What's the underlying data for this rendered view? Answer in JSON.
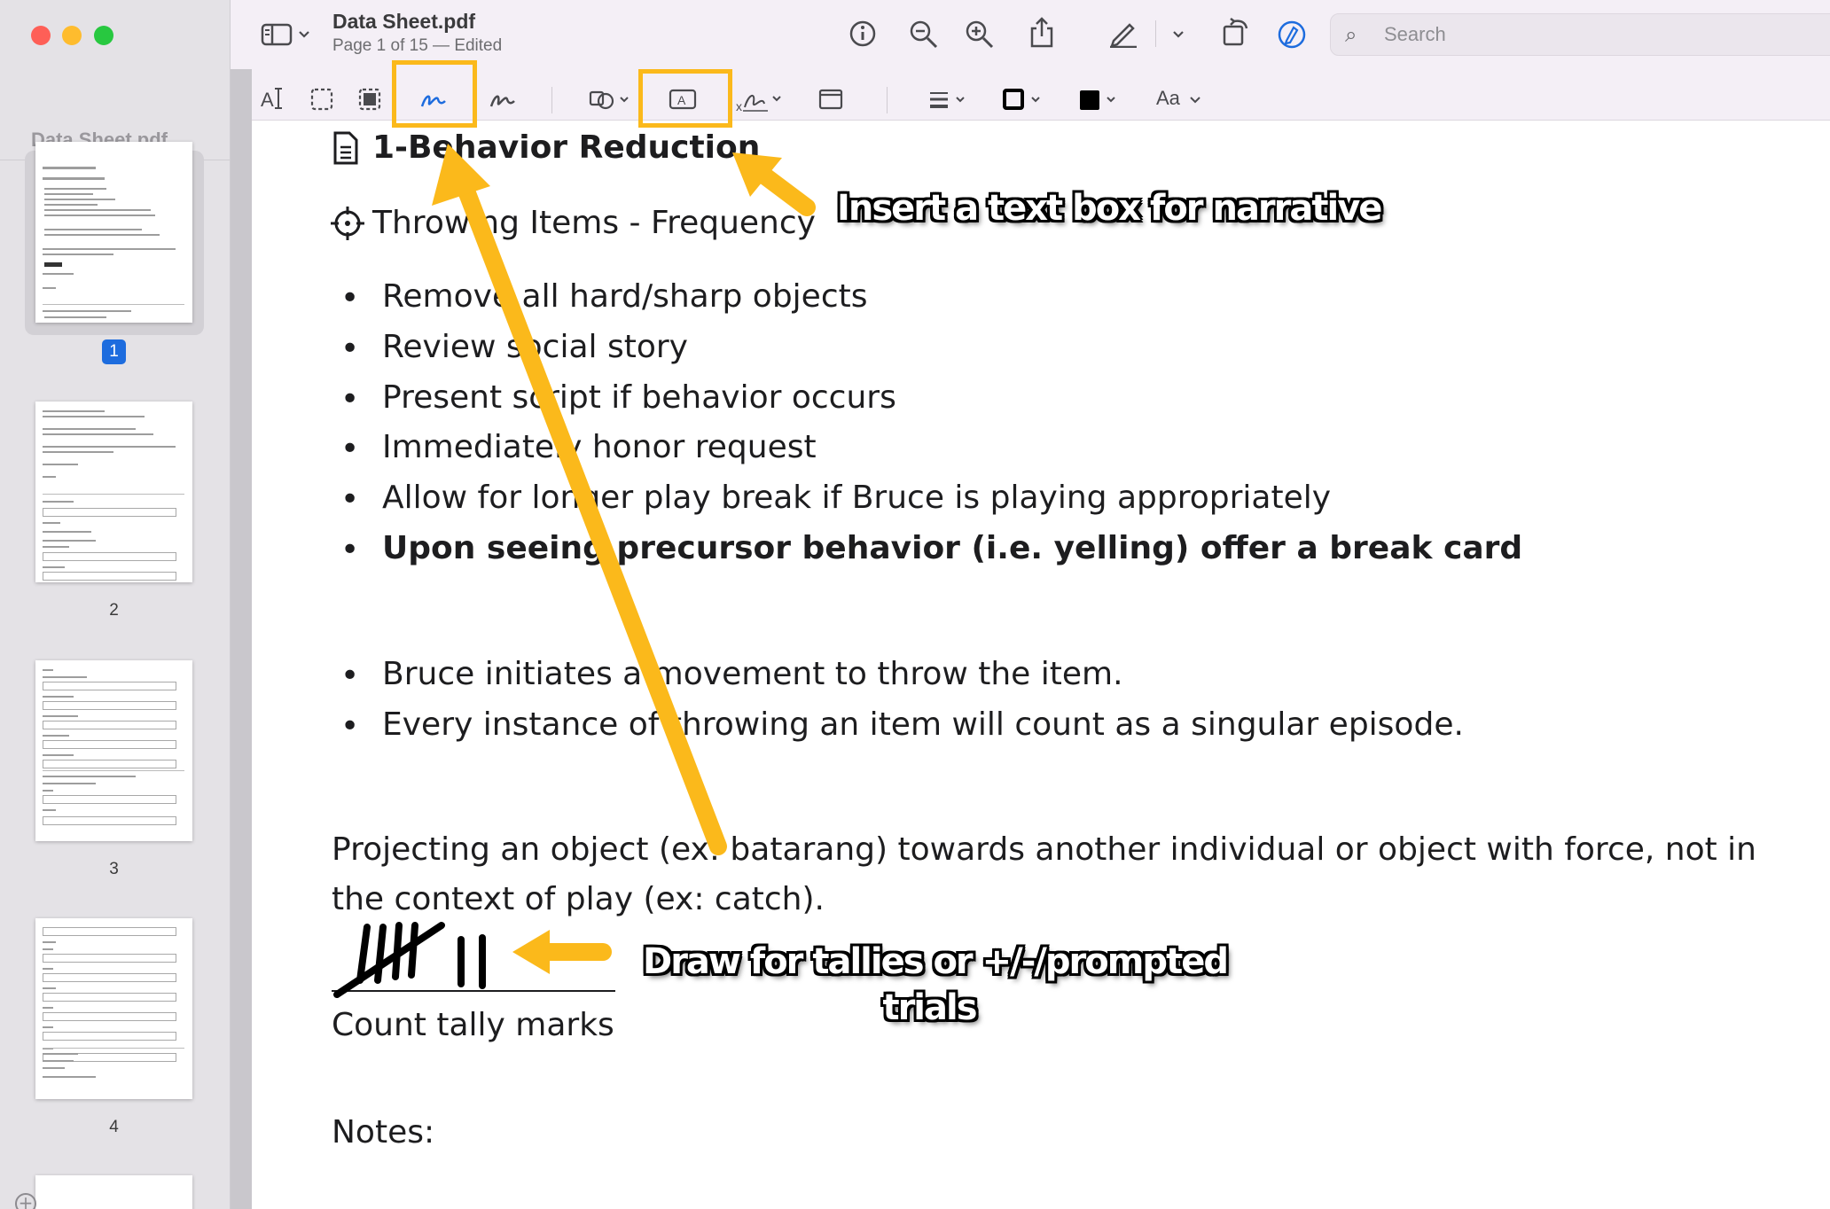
{
  "window": {
    "title": "Data Sheet.pdf",
    "subtitle": "Page 1 of 15 — Edited"
  },
  "sidebar": {
    "title": "Data Sheet.pdf",
    "pages": [
      {
        "label": "1",
        "selected": true
      },
      {
        "label": "2",
        "selected": false
      },
      {
        "label": "3",
        "selected": false
      },
      {
        "label": "4",
        "selected": false
      }
    ]
  },
  "search": {
    "placeholder": "Search"
  },
  "toolbar": {
    "icons": [
      "sidebar-toggle-icon",
      "chevron-down-icon",
      "info-icon",
      "zoom-out-icon",
      "zoom-in-icon",
      "share-icon",
      "markup-pen-icon",
      "chevron-down-icon",
      "rotate-icon",
      "markup-circle-icon"
    ]
  },
  "markup_toolbar": {
    "icons": [
      "text-selection-icon",
      "rectangular-selection-icon",
      "redact-icon",
      "sketch-icon",
      "draw-icon",
      "shapes-icon",
      "text-box-icon",
      "sign-icon",
      "note-icon",
      "shape-style-icon",
      "border-color-icon",
      "fill-color-icon",
      "text-style-icon"
    ],
    "text_style_label": "Aa"
  },
  "document": {
    "section_title": "1-Behavior Reduction",
    "target_title": "Throwing Items - Frequency",
    "strategies": [
      {
        "text": "Remove all hard/sharp objects",
        "bold": false
      },
      {
        "text": "Review social story",
        "bold": false
      },
      {
        "text": "Present script if behavior occurs",
        "bold": false
      },
      {
        "text": "Immediately honor request",
        "bold": false
      },
      {
        "text": "Allow for longer play break if Bruce is playing appropriately",
        "bold": false
      },
      {
        "text": "Upon seeing precursor behavior (i.e. yelling) offer a break card",
        "bold": true
      }
    ],
    "definitions": [
      {
        "text": "Bruce initiates a movement to throw the item."
      },
      {
        "text": "Every instance of throwing an item will count as a singular episode."
      }
    ],
    "definition_line1": "Projecting an object (ex: batarang) towards another individual or object with force, not in",
    "definition_line2": "the context of play (ex: catch).",
    "tally_label": "Count tally marks",
    "notes_label": "Notes:"
  },
  "annotations": {
    "textbox_callout": "Insert a text box for narrative",
    "draw_callout_line1": "Draw for tallies or +/-/prompted",
    "draw_callout_line2": "trials",
    "accent_color": "#fbb91b"
  },
  "colors": {
    "selection_blue": "#1d6cde",
    "toolbar_bg": "#f4eff6",
    "sidebar_bg": "#e4e2e6"
  }
}
